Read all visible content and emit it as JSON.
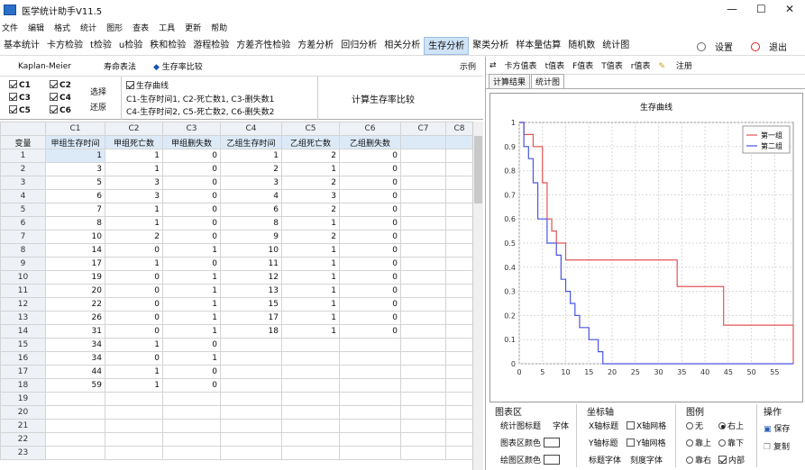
{
  "window": {
    "title": "医学统计助手V11.5",
    "minimize": "—",
    "maximize": "☐",
    "close": "✕"
  },
  "menu": [
    "文件",
    "编辑",
    "格式",
    "统计",
    "图形",
    "查表",
    "工具",
    "更新",
    "帮助"
  ],
  "toolbar": {
    "items": [
      "基本统计",
      "卡方检验",
      "t检验",
      "u检验",
      "秩和检验",
      "游程检验",
      "方差齐性检验",
      "方差分析",
      "回归分析",
      "相关分析",
      "生存分析",
      "聚类分析",
      "样本量估算",
      "随机数",
      "统计图"
    ],
    "active": "生存分析",
    "settings": "设置",
    "exit": "退出"
  },
  "method": {
    "km": "Kaplan-Meier",
    "life": "寿命表法",
    "compare": "生存率比较",
    "example": "示例"
  },
  "options": {
    "checks": [
      {
        "label": "C1",
        "checked": true
      },
      {
        "label": "C2",
        "checked": true
      },
      {
        "label": "C3",
        "checked": true
      },
      {
        "label": "C4",
        "checked": true
      },
      {
        "label": "C5",
        "checked": true
      },
      {
        "label": "C6",
        "checked": true
      }
    ],
    "select": "选择",
    "restore": "还原",
    "curve_label": "生存曲线",
    "desc1": "C1-生存时间1, C2-死亡数1, C3-删失数1",
    "desc2": "C4-生存时间2, C5-死亡数2, C6-删失数2",
    "compute": "计算生存率比较"
  },
  "grid": {
    "columns": [
      "",
      "C1",
      "C2",
      "C3",
      "C4",
      "C5",
      "C6",
      "C7",
      "C8"
    ],
    "var_row": [
      "变量",
      "甲组生存时间",
      "甲组死亡数",
      "甲组删失数",
      "乙组生存时间",
      "乙组死亡数",
      "乙组删失数",
      "",
      ""
    ],
    "rows": [
      [
        "1",
        "1",
        "1",
        "0",
        "1",
        "2",
        "0"
      ],
      [
        "2",
        "3",
        "1",
        "0",
        "2",
        "1",
        "0"
      ],
      [
        "3",
        "5",
        "3",
        "0",
        "3",
        "2",
        "0"
      ],
      [
        "4",
        "6",
        "3",
        "0",
        "4",
        "3",
        "0"
      ],
      [
        "5",
        "7",
        "1",
        "0",
        "6",
        "2",
        "0"
      ],
      [
        "6",
        "8",
        "1",
        "0",
        "8",
        "1",
        "0"
      ],
      [
        "7",
        "10",
        "2",
        "0",
        "9",
        "2",
        "0"
      ],
      [
        "8",
        "14",
        "0",
        "1",
        "10",
        "1",
        "0"
      ],
      [
        "9",
        "17",
        "1",
        "0",
        "11",
        "1",
        "0"
      ],
      [
        "10",
        "19",
        "0",
        "1",
        "12",
        "1",
        "0"
      ],
      [
        "11",
        "20",
        "0",
        "1",
        "13",
        "1",
        "0"
      ],
      [
        "12",
        "22",
        "0",
        "1",
        "15",
        "1",
        "0"
      ],
      [
        "13",
        "26",
        "0",
        "1",
        "17",
        "1",
        "0"
      ],
      [
        "14",
        "31",
        "0",
        "1",
        "18",
        "1",
        "0"
      ],
      [
        "15",
        "34",
        "1",
        "0",
        "",
        "",
        ""
      ],
      [
        "16",
        "34",
        "0",
        "1",
        "",
        "",
        ""
      ],
      [
        "17",
        "44",
        "1",
        "0",
        "",
        "",
        ""
      ],
      [
        "18",
        "59",
        "1",
        "0",
        "",
        "",
        ""
      ],
      [
        "19",
        "",
        "",
        "",
        "",
        "",
        ""
      ],
      [
        "20",
        "",
        "",
        "",
        "",
        "",
        ""
      ],
      [
        "21",
        "",
        "",
        "",
        "",
        "",
        ""
      ],
      [
        "22",
        "",
        "",
        "",
        "",
        "",
        ""
      ],
      [
        "23",
        "",
        "",
        "",
        "",
        "",
        ""
      ]
    ]
  },
  "right_toolbar": [
    "卡方值表",
    "t值表",
    "F值表",
    "T值表",
    "r值表",
    "注册"
  ],
  "right_tabs": [
    "计算结果",
    "统计图"
  ],
  "right_tab_active": "统计图",
  "colors": {
    "group1": "#e05555",
    "group2": "#4a55e0",
    "accent": "#cfe3f7"
  },
  "chart_data": {
    "type": "line",
    "title": "生存曲线",
    "xlim": [
      0,
      59
    ],
    "ylim": [
      0,
      1
    ],
    "xticks": [
      0,
      5,
      10,
      15,
      20,
      25,
      30,
      35,
      40,
      45,
      50,
      55
    ],
    "yticks": [
      0,
      0.1,
      0.2,
      0.3,
      0.4,
      0.5,
      0.6,
      0.7,
      0.8,
      0.9,
      1
    ],
    "grid": true,
    "legend": "top-right",
    "series": [
      {
        "name": "第一组",
        "color": "#e05555",
        "steps": [
          [
            0,
            1
          ],
          [
            1,
            0.95
          ],
          [
            3,
            0.9
          ],
          [
            5,
            0.75
          ],
          [
            6,
            0.6
          ],
          [
            7,
            0.55
          ],
          [
            8,
            0.5
          ],
          [
            10,
            0.43
          ],
          [
            34,
            0.32
          ],
          [
            44,
            0.16
          ],
          [
            59,
            0.0
          ]
        ]
      },
      {
        "name": "第二组",
        "color": "#4a55e0",
        "steps": [
          [
            0,
            1
          ],
          [
            1,
            0.9
          ],
          [
            2,
            0.85
          ],
          [
            3,
            0.75
          ],
          [
            4,
            0.6
          ],
          [
            6,
            0.5
          ],
          [
            8,
            0.45
          ],
          [
            9,
            0.35
          ],
          [
            10,
            0.3
          ],
          [
            11,
            0.25
          ],
          [
            12,
            0.2
          ],
          [
            13,
            0.15
          ],
          [
            15,
            0.1
          ],
          [
            17,
            0.05
          ],
          [
            18,
            0.0
          ],
          [
            59,
            0.0
          ]
        ]
      }
    ]
  },
  "settings": {
    "chart_area": "图表区",
    "chart_title": "统计图标题",
    "font": "字体",
    "chart_bg": "图表区颜色",
    "plot_bg": "绘图区颜色",
    "axis": "坐标轴",
    "xtitle": "X轴标题",
    "xgrid": "X轴网格",
    "ytitle": "Y轴标题",
    "ygrid": "Y轴网格",
    "title_font": "标题字体",
    "tick_font": "刻度字体",
    "legend": "图例",
    "legend_none": "无",
    "legend_topright": "右上",
    "legend_top": "靠上",
    "legend_bottom": "靠下",
    "legend_right": "靠右",
    "legend_inside": "内部",
    "ops": "操作",
    "save": "保存",
    "copy": "复制"
  }
}
